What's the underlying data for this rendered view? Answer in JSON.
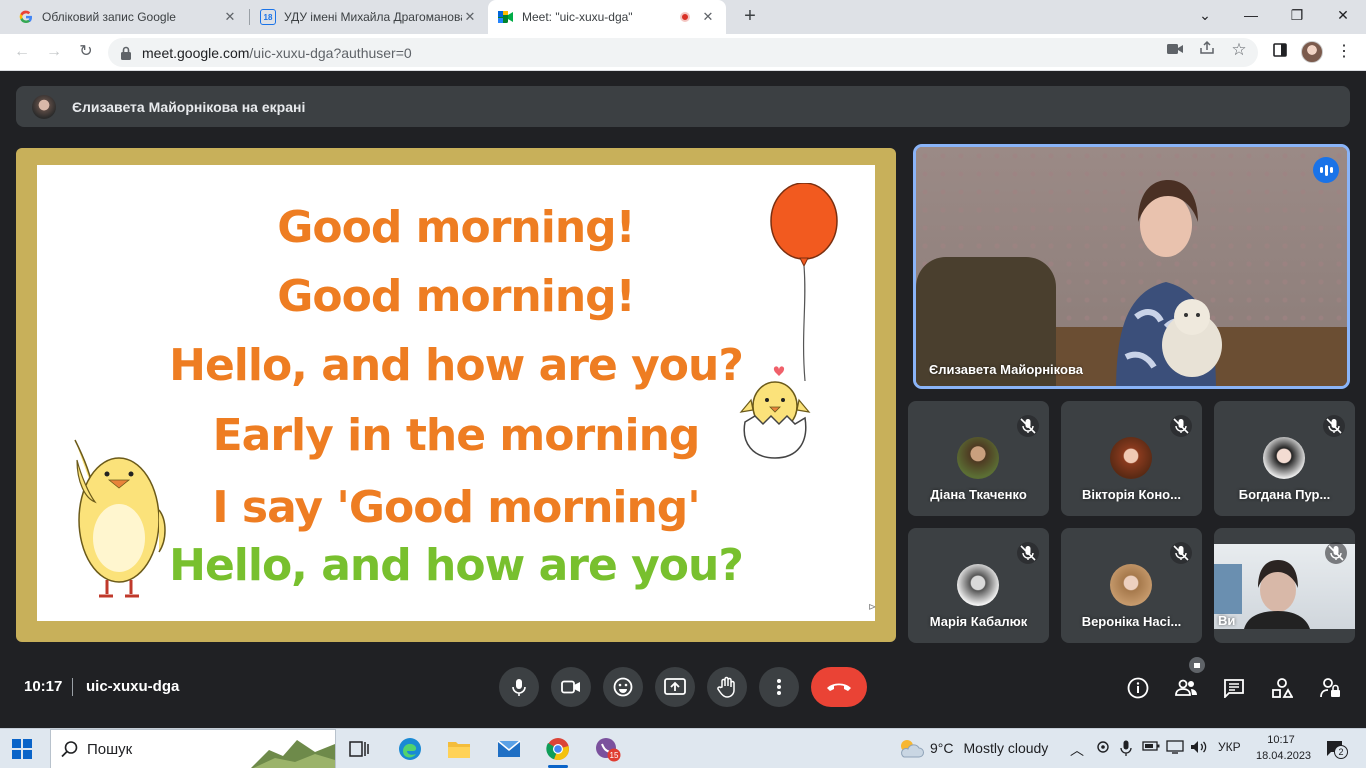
{
  "browser": {
    "tabs": [
      {
        "title": "Обліковий запис Google",
        "icon": "google-g-icon"
      },
      {
        "title": "УДУ імені Михайла Драгоманова",
        "icon": "calendar-18-icon",
        "icon_text": "18"
      },
      {
        "title": "Meet: \"uic-xuxu-dga\"",
        "icon": "meet-icon",
        "recording": true
      }
    ],
    "url_host": "meet.google.com",
    "url_path": "/uic-xuxu-dga?authuser=0"
  },
  "meet": {
    "presenting_label": "Єлизавета Майорнікова на екрані",
    "slide": {
      "lines": [
        {
          "text": "Good morning!",
          "color": "#ee7d22"
        },
        {
          "text": "Good morning!",
          "color": "#ee7d22"
        },
        {
          "text": "Hello, and how are you?",
          "color": "#ee7d22"
        },
        {
          "text": "Early in the morning",
          "color": "#ee7d22"
        },
        {
          "text": "I say 'Good morning'",
          "color": "#ee7d22"
        },
        {
          "text": "Hello, and how are you?",
          "color": "#78c02e"
        }
      ]
    },
    "main_participant": {
      "name": "Єлизавета Майорнікова",
      "speaking": true
    },
    "participants": [
      {
        "name": "Діана Ткаченко",
        "muted": true
      },
      {
        "name": "Вікторія Коно...",
        "muted": true
      },
      {
        "name": "Богдана Пур...",
        "muted": true
      },
      {
        "name": "Марія Кабалюк",
        "muted": true
      },
      {
        "name": "Вероніка Насі...",
        "muted": true
      },
      {
        "name": "Ви",
        "muted": true
      }
    ],
    "time": "10:17",
    "meeting_code": "uic-xuxu-dga",
    "accent_color": "#8ab4f8",
    "end_call_color": "#ea4335"
  },
  "taskbar": {
    "search_label": "Пошук",
    "weather_temp": "9°C",
    "weather_text": "Mostly cloudy",
    "language": "УКР",
    "clock_time": "10:17",
    "clock_date": "18.04.2023",
    "notifications": "2",
    "viber_badge": "15"
  }
}
